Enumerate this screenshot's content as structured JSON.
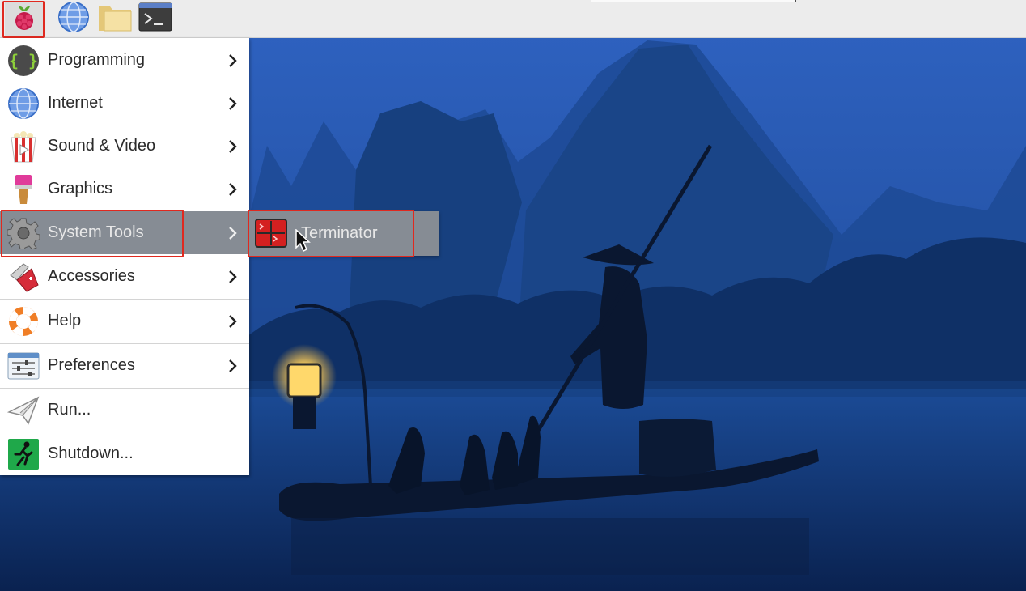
{
  "taskbar": {
    "launchers": [
      {
        "name": "menu",
        "icon": "raspberry-pi-icon"
      },
      {
        "name": "web-browser",
        "icon": "globe-icon"
      },
      {
        "name": "file-manager",
        "icon": "folder-icon"
      },
      {
        "name": "terminal",
        "icon": "terminal-icon"
      }
    ]
  },
  "main_menu": {
    "items": [
      {
        "label": "Programming",
        "icon": "code-braces-icon",
        "has_submenu": true
      },
      {
        "label": "Internet",
        "icon": "globe-icon",
        "has_submenu": true
      },
      {
        "label": "Sound & Video",
        "icon": "popcorn-icon",
        "has_submenu": true
      },
      {
        "label": "Graphics",
        "icon": "paintbrush-icon",
        "has_submenu": true
      },
      {
        "label": "System Tools",
        "icon": "gear-icon",
        "has_submenu": true,
        "active": true
      },
      {
        "label": "Accessories",
        "icon": "pocket-knife-icon",
        "has_submenu": true
      },
      {
        "label": "Help",
        "icon": "lifebuoy-icon",
        "has_submenu": true
      },
      {
        "label": "Preferences",
        "icon": "sliders-icon",
        "has_submenu": true
      },
      {
        "label": "Run...",
        "icon": "paper-plane-icon",
        "has_submenu": false
      },
      {
        "label": "Shutdown...",
        "icon": "exit-running-icon",
        "has_submenu": false
      }
    ]
  },
  "submenu": {
    "items": [
      {
        "label": "Terminator",
        "icon": "terminator-icon"
      }
    ]
  },
  "colors": {
    "active_item": "#868c94",
    "highlight_border": "#e0291f",
    "panel": "#ececec"
  }
}
